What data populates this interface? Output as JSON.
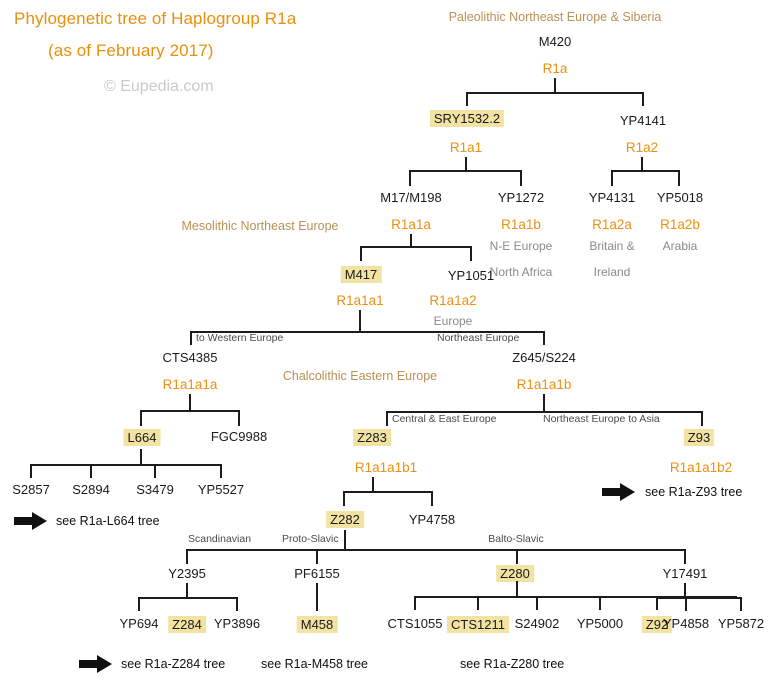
{
  "header": {
    "title_line1": "Phylogenetic tree of Haplogroup R1a",
    "title_line2": "(as of February 2017)",
    "copyright": "© Eupedia.com"
  },
  "eras": {
    "paleolithic": "Paleolithic Northeast Europe & Siberia",
    "mesolithic": "Mesolithic Northeast Europe",
    "chalcolithic": "Chalcolithic Eastern Europe"
  },
  "nodes": {
    "m420": {
      "snp": "M420",
      "hg": "R1a"
    },
    "sry1532": {
      "snp": "SRY1532.2",
      "hg": "R1a1"
    },
    "yp4141": {
      "snp": "YP4141",
      "hg": "R1a2"
    },
    "m17": {
      "snp": "M17/M198",
      "hg": "R1a1a"
    },
    "yp1272": {
      "snp": "YP1272",
      "hg": "R1a1b",
      "region1": "N-E Europe",
      "region2": "North Africa"
    },
    "yp4131": {
      "snp": "YP4131",
      "hg": "R1a2a",
      "region1": "Britain &",
      "region2": "Ireland"
    },
    "yp5018": {
      "snp": "YP5018",
      "hg": "R1a2b",
      "region1": "Arabia"
    },
    "m417": {
      "snp": "M417",
      "hg": "R1a1a1"
    },
    "yp1051": {
      "snp": "YP1051",
      "hg": "R1a1a2",
      "region1": "Europe"
    },
    "cts4385": {
      "snp": "CTS4385",
      "hg": "R1a1a1a"
    },
    "z645": {
      "snp": "Z645/S224",
      "hg": "R1a1a1b"
    },
    "l664": {
      "snp": "L664"
    },
    "fgc9988": {
      "snp": "FGC9988"
    },
    "s2857": {
      "snp": "S2857"
    },
    "s2894": {
      "snp": "S2894"
    },
    "s3479": {
      "snp": "S3479"
    },
    "yp5527": {
      "snp": "YP5527"
    },
    "z283": {
      "snp": "Z283",
      "hg": "R1a1a1b1"
    },
    "z93": {
      "snp": "Z93",
      "hg": "R1a1a1b2"
    },
    "z282": {
      "snp": "Z282"
    },
    "yp4758": {
      "snp": "YP4758"
    },
    "y2395": {
      "snp": "Y2395"
    },
    "pf6155": {
      "snp": "PF6155"
    },
    "z280": {
      "snp": "Z280"
    },
    "y17491": {
      "snp": "Y17491"
    },
    "yp694": {
      "snp": "YP694"
    },
    "z284": {
      "snp": "Z284"
    },
    "yp3896": {
      "snp": "YP3896"
    },
    "m458": {
      "snp": "M458"
    },
    "cts1055": {
      "snp": "CTS1055"
    },
    "cts1211": {
      "snp": "CTS1211"
    },
    "s24902": {
      "snp": "S24902"
    },
    "yp5000": {
      "snp": "YP5000"
    },
    "z92": {
      "snp": "Z92"
    },
    "yp4858": {
      "snp": "YP4858"
    },
    "yp5872": {
      "snp": "YP5872"
    }
  },
  "branch_labels": {
    "to_western_europe": "to Western Europe",
    "northeast_europe": "Northeast Europe",
    "central_east_europe": "Central & East Europe",
    "northeast_europe_asia": "Northeast Europe to Asia",
    "scandinavian": "Scandinavian",
    "proto_slavic": "Proto-Slavic",
    "balto_slavic": "Balto-Slavic"
  },
  "see_trees": {
    "l664": "see R1a-L664 tree",
    "z93": "see R1a-Z93 tree",
    "z284": "see R1a-Z284 tree",
    "m458": "see R1a-M458 tree",
    "z280": "see R1a-Z280 tree"
  },
  "colors": {
    "title_orange": "#E8900C",
    "haplogroup_orange": "#ED9010",
    "era_tan": "#B99055",
    "highlight_yellow": "#F2E3A3",
    "region_gray": "#8a8a8a",
    "line_black": "#1c1c1c"
  }
}
